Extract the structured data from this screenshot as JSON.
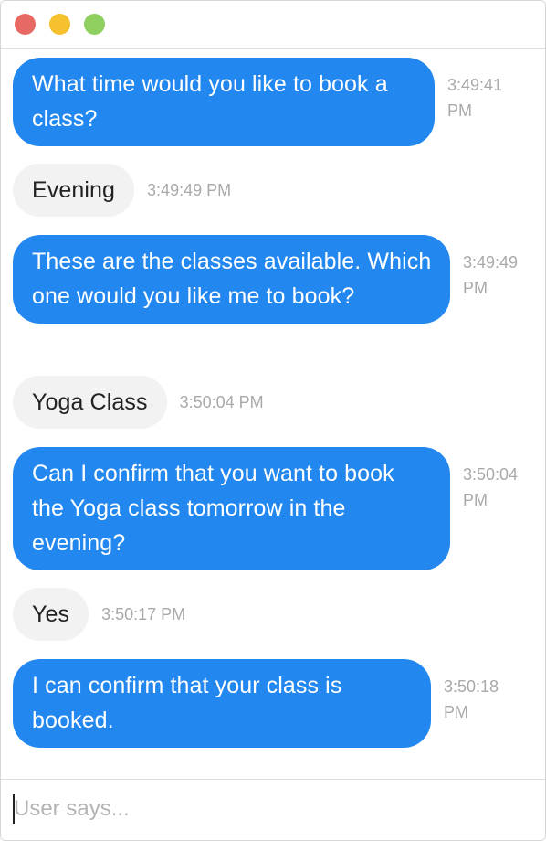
{
  "window": {
    "traffic_lights": [
      "close",
      "minimize",
      "zoom"
    ],
    "colors": {
      "bot_bubble": "#2288f0",
      "user_bubble": "#f2f2f2",
      "timestamp": "#a9a9a9"
    }
  },
  "messages": [
    {
      "sender": "bot",
      "text": "What time would you like to book a class?",
      "time": "3:49:41 PM"
    },
    {
      "sender": "user",
      "text": "Evening",
      "time": "3:49:49 PM"
    },
    {
      "sender": "bot",
      "text": "These are the classes available. Which one would you like me to book?",
      "time": "3:49:49 PM"
    },
    {
      "sender": "user",
      "text": "Yoga Class",
      "time": "3:50:04 PM"
    },
    {
      "sender": "bot",
      "text": "Can I confirm that you want to book the Yoga class tomorrow in the evening?",
      "time": "3:50:04 PM"
    },
    {
      "sender": "user",
      "text": "Yes",
      "time": "3:50:17 PM"
    },
    {
      "sender": "bot",
      "text": "I can confirm that your class is booked.",
      "time": "3:50:18 PM"
    }
  ],
  "composer": {
    "placeholder": "User says...",
    "value": ""
  }
}
